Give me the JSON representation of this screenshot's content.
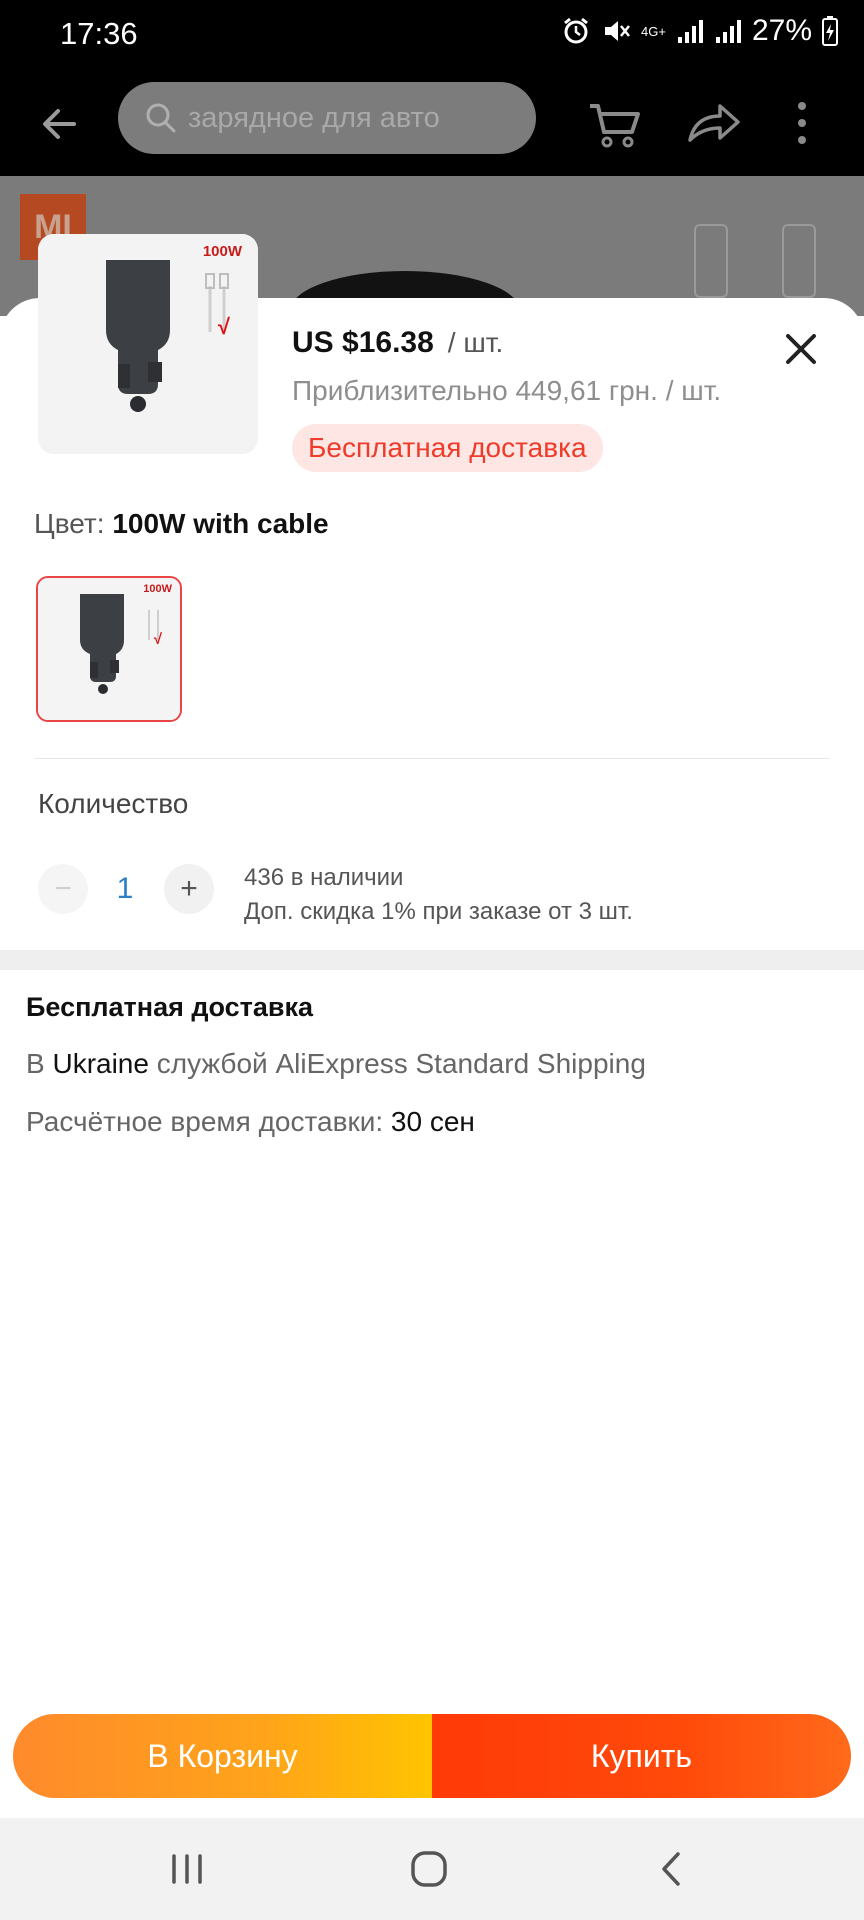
{
  "status_bar": {
    "time": "17:36",
    "network": "4G+",
    "battery_percent": "27%"
  },
  "header": {
    "search_placeholder": "зарядное для авто"
  },
  "background_product": {
    "brand_logo": "MI"
  },
  "sheet": {
    "price": "US $16.38",
    "unit": "/ шт.",
    "approx_price": "Приблизительно 449,61 грн. / шт.",
    "free_shipping_badge": "Бесплатная доставка",
    "product_thumb_label": "100W",
    "color_label": "Цвет:",
    "color_value": "100W with cable",
    "variant_label": "100W",
    "quantity_label": "Количество",
    "quantity_value": "1",
    "quantity_minus": "−",
    "quantity_plus": "+",
    "stock_text": "436 в наличии",
    "discount_text": "Доп. скидка 1% при заказе от 3 шт."
  },
  "shipping": {
    "title": "Бесплатная доставка",
    "prefix": "В",
    "country": "Ukraine",
    "method": "службой AliExpress Standard Shipping",
    "eta_label": "Расчётное время доставки:",
    "eta_value": "30 сен"
  },
  "actions": {
    "add_to_cart": "В Корзину",
    "buy_now": "Купить"
  },
  "colors": {
    "accent_red": "#ee3b2a",
    "cart_orange": "#ffa41a",
    "buy_red": "#ff3a08",
    "quantity_blue": "#2a7fc9"
  }
}
